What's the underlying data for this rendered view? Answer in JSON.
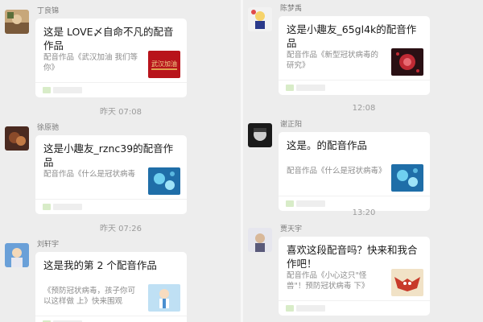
{
  "chats": {
    "left": [
      {
        "sender": "丁良锦",
        "title": "这是 LOVE〆自命不凡的配音作品",
        "desc": "配音作品《武汉加油 我们等你》",
        "avatar_icon": "user-avatar-1",
        "thumb_icon": "wuhan-jiayou-thumbnail",
        "thumb_text": "武汉加油"
      },
      {
        "sender": "徐原驰",
        "title": "这是小趣友_rznc39的配音作品",
        "desc": "配音作品《什么是冠状病毒",
        "avatar_icon": "user-avatar-2",
        "thumb_icon": "virus-blue-thumbnail"
      },
      {
        "sender": "刘轩宇",
        "title": "这是我的第 2 个配音作品",
        "desc": "《预防冠状病毒，孩子你可以这样做 上》快来围观",
        "avatar_icon": "user-avatar-3",
        "thumb_icon": "kid-cartoon-thumbnail"
      }
    ],
    "right": [
      {
        "sender": "陈梦禹",
        "title": "这是小趣友_65gl4k的配音作品",
        "desc": "配音作品《新型冠状病毒的研究》",
        "avatar_icon": "user-avatar-4",
        "thumb_icon": "virus-red-thumbnail"
      },
      {
        "sender": "谢正阳",
        "title": "这是。的配音作品",
        "desc": "配音作品《什么是冠状病毒》",
        "avatar_icon": "user-avatar-5",
        "thumb_icon": "virus-blue-thumbnail"
      },
      {
        "sender": "贾天宇",
        "title": "喜欢这段配音吗？快来和我合作吧！",
        "desc": "配音作品《小心这只\"怪兽\"！预防冠状病毒 下》",
        "avatar_icon": "user-avatar-6",
        "thumb_icon": "bat-monster-thumbnail"
      }
    ]
  },
  "timestamps": {
    "left": [
      "昨天 07:08",
      "昨天 07:26"
    ],
    "right": [
      "12:08",
      "13:20"
    ]
  },
  "colors": {
    "background": "#ededed",
    "bubble": "#ffffff",
    "thumb_red": "#b8141b",
    "thumb_blue": "#1f6ea8"
  }
}
